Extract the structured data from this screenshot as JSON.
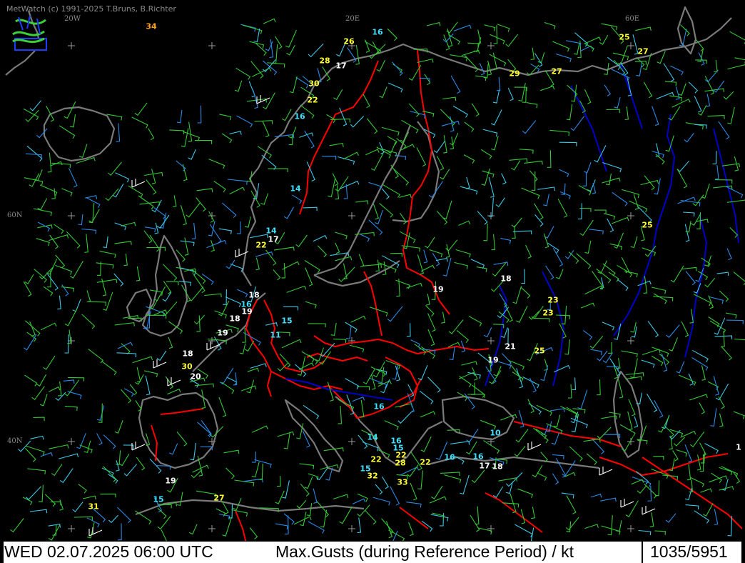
{
  "app": {
    "copyright": "MetWatch  (c) 1991-2025 T.Bruns, B.Richter",
    "logo_text": "MetWatch"
  },
  "grid_labels": {
    "lon_20w": "20W",
    "lon_20e": "20E",
    "lon_60e": "60E",
    "lat_60n": "60N",
    "lat_40n": "40N"
  },
  "status": {
    "datetime": "WED 02.07.2025 06:00 UTC",
    "parameter": "Max.Gusts (during Reference Period) / kt",
    "frame_counter": "1035/5951"
  },
  "colors": {
    "background": "#000000",
    "coastline": "#7a7a7a",
    "border": "#ff0000",
    "river": "#0000c8",
    "wind_green": "#35c835",
    "wind_blue": "#2a8ae6",
    "wind_cyan": "#3cc8e6",
    "wind_white": "#ffffff",
    "value_yellow": "#ffff30",
    "value_cyan": "#40e0ff",
    "value_white": "#ffffff",
    "value_orange": "#ffa020"
  },
  "gust_values": [
    {
      "text": "34",
      "color": "orange"
    },
    {
      "text": "16",
      "color": "cyan"
    },
    {
      "text": "26",
      "color": "yellow"
    },
    {
      "text": "25",
      "color": "yellow"
    },
    {
      "text": "27",
      "color": "yellow"
    },
    {
      "text": "28",
      "color": "yellow"
    },
    {
      "text": "17",
      "color": "white"
    },
    {
      "text": "29",
      "color": "yellow"
    },
    {
      "text": "27",
      "color": "yellow"
    },
    {
      "text": "30",
      "color": "yellow"
    },
    {
      "text": "22",
      "color": "yellow"
    },
    {
      "text": "16",
      "color": "cyan"
    },
    {
      "text": "14",
      "color": "cyan"
    },
    {
      "text": "14",
      "color": "cyan"
    },
    {
      "text": "17",
      "color": "white"
    },
    {
      "text": "22",
      "color": "yellow"
    },
    {
      "text": "25",
      "color": "yellow"
    },
    {
      "text": "18",
      "color": "white"
    },
    {
      "text": "19",
      "color": "white"
    },
    {
      "text": "18",
      "color": "white"
    },
    {
      "text": "16",
      "color": "cyan"
    },
    {
      "text": "19",
      "color": "white"
    },
    {
      "text": "18",
      "color": "white"
    },
    {
      "text": "15",
      "color": "cyan"
    },
    {
      "text": "23",
      "color": "yellow"
    },
    {
      "text": "23",
      "color": "yellow"
    },
    {
      "text": "19",
      "color": "white"
    },
    {
      "text": "11",
      "color": "cyan"
    },
    {
      "text": "21",
      "color": "white"
    },
    {
      "text": "25",
      "color": "yellow"
    },
    {
      "text": "18",
      "color": "white"
    },
    {
      "text": "19",
      "color": "white"
    },
    {
      "text": "30",
      "color": "yellow"
    },
    {
      "text": "20",
      "color": "white"
    },
    {
      "text": "16",
      "color": "cyan"
    },
    {
      "text": "10",
      "color": "cyan"
    },
    {
      "text": "14",
      "color": "cyan"
    },
    {
      "text": "16",
      "color": "cyan"
    },
    {
      "text": "15",
      "color": "cyan"
    },
    {
      "text": "22",
      "color": "yellow"
    },
    {
      "text": "22",
      "color": "yellow"
    },
    {
      "text": "28",
      "color": "yellow"
    },
    {
      "text": "22",
      "color": "yellow"
    },
    {
      "text": "16",
      "color": "cyan"
    },
    {
      "text": "16",
      "color": "cyan"
    },
    {
      "text": "17",
      "color": "white"
    },
    {
      "text": "18",
      "color": "white"
    },
    {
      "text": "15",
      "color": "cyan"
    },
    {
      "text": "32",
      "color": "yellow"
    },
    {
      "text": "33",
      "color": "yellow"
    },
    {
      "text": "19",
      "color": "white"
    },
    {
      "text": "27",
      "color": "yellow"
    },
    {
      "text": "15",
      "color": "cyan"
    },
    {
      "text": "31",
      "color": "yellow"
    },
    {
      "text": "1",
      "color": "white"
    }
  ]
}
